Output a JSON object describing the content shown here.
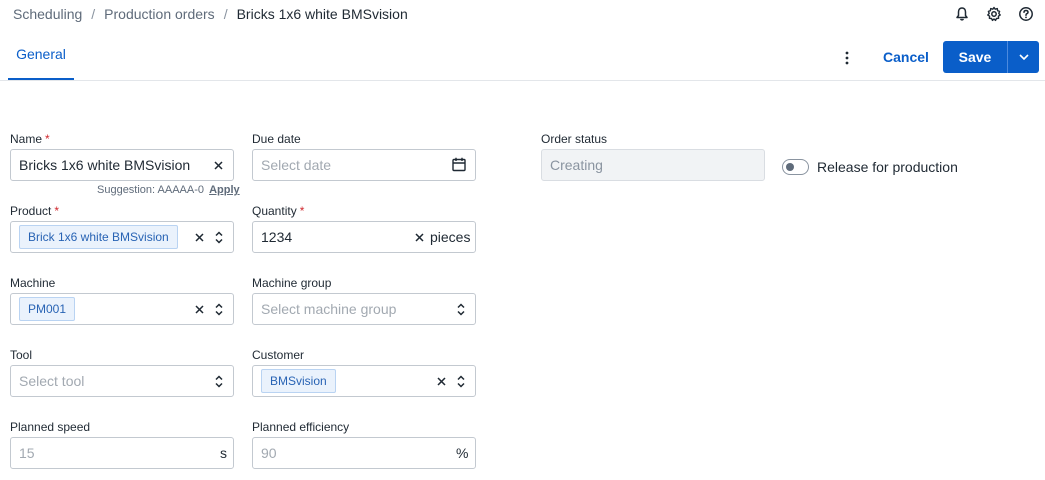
{
  "breadcrumb": {
    "items": [
      "Scheduling",
      "Production orders"
    ],
    "current": "Bricks 1x6 white BMSvision",
    "separator": "/"
  },
  "header_icons": [
    "bell-icon",
    "gear-icon",
    "help-icon"
  ],
  "tabs": [
    {
      "label": "General",
      "active": true
    }
  ],
  "actions": {
    "cancel_label": "Cancel",
    "save_label": "Save"
  },
  "form": {
    "name": {
      "label": "Name",
      "required": "*",
      "value": "Bricks 1x6 white BMSvision"
    },
    "suggestion": {
      "text": "Suggestion: AAAAA-0",
      "action": "Apply"
    },
    "due_date": {
      "label": "Due date",
      "placeholder": "Select date"
    },
    "order_status": {
      "label": "Order status",
      "value": "Creating"
    },
    "release": {
      "label": "Release for production",
      "checked": false
    },
    "product": {
      "label": "Product",
      "required": "*",
      "value": "Brick 1x6 white BMSvision"
    },
    "quantity": {
      "label": "Quantity",
      "required": "*",
      "value": "1234",
      "unit": "pieces"
    },
    "machine": {
      "label": "Machine",
      "value": "PM001"
    },
    "machine_group": {
      "label": "Machine group",
      "placeholder": "Select machine group"
    },
    "tool": {
      "label": "Tool",
      "placeholder": "Select tool"
    },
    "customer": {
      "label": "Customer",
      "value": "BMSvision"
    },
    "planned_speed": {
      "label": "Planned speed",
      "placeholder": "15",
      "unit": "s"
    },
    "planned_efficiency": {
      "label": "Planned efficiency",
      "placeholder": "90",
      "unit": "%"
    }
  },
  "colors": {
    "accent": "#0a5ec9",
    "required": "#d0282e",
    "chip_bg": "#eaf2fc"
  }
}
